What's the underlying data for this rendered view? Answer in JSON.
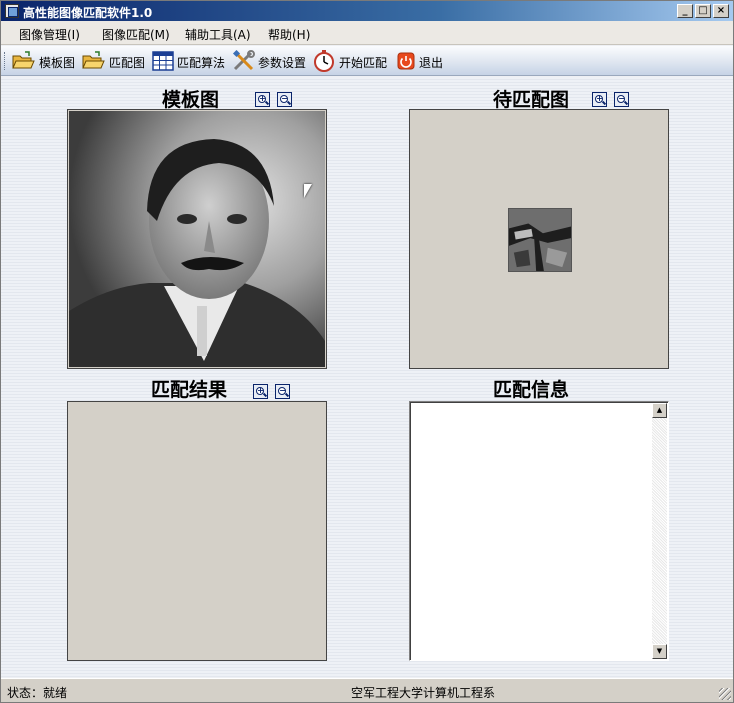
{
  "window": {
    "title": "高性能图像匹配软件1.0",
    "controls": {
      "minimize": "_",
      "maximize": "□",
      "close": "×"
    }
  },
  "menu": {
    "items": [
      {
        "label": "图像管理(I)"
      },
      {
        "label": "图像匹配(M)"
      },
      {
        "label": "辅助工具(A)"
      },
      {
        "label": "帮助(H)"
      }
    ]
  },
  "toolbar": {
    "items": [
      {
        "label": "模板图",
        "icon": "open-folder-icon"
      },
      {
        "label": "匹配图",
        "icon": "open-folder-icon"
      },
      {
        "label": "匹配算法",
        "icon": "grid-table-icon"
      },
      {
        "label": "参数设置",
        "icon": "tools-icon"
      },
      {
        "label": "开始匹配",
        "icon": "stopwatch-icon"
      },
      {
        "label": "退出",
        "icon": "power-icon"
      }
    ]
  },
  "panels": {
    "template": {
      "title": "模板图",
      "zoom_in": "+",
      "zoom_out": "−"
    },
    "target": {
      "title": "待匹配图",
      "zoom_in": "+",
      "zoom_out": "−"
    },
    "result": {
      "title": "匹配结果",
      "zoom_in": "+",
      "zoom_out": "−"
    },
    "info": {
      "title": "匹配信息",
      "content": ""
    }
  },
  "scrollbar": {
    "up": "▲",
    "down": "▼"
  },
  "status": {
    "state": "状态：就绪",
    "organization": "空军工程大学计算机工程系"
  },
  "colors": {
    "titlebar_start": "#0a246a",
    "titlebar_end": "#a6caf0",
    "image_bg": "#d4d0c8",
    "exit_icon": "#e8491d"
  }
}
